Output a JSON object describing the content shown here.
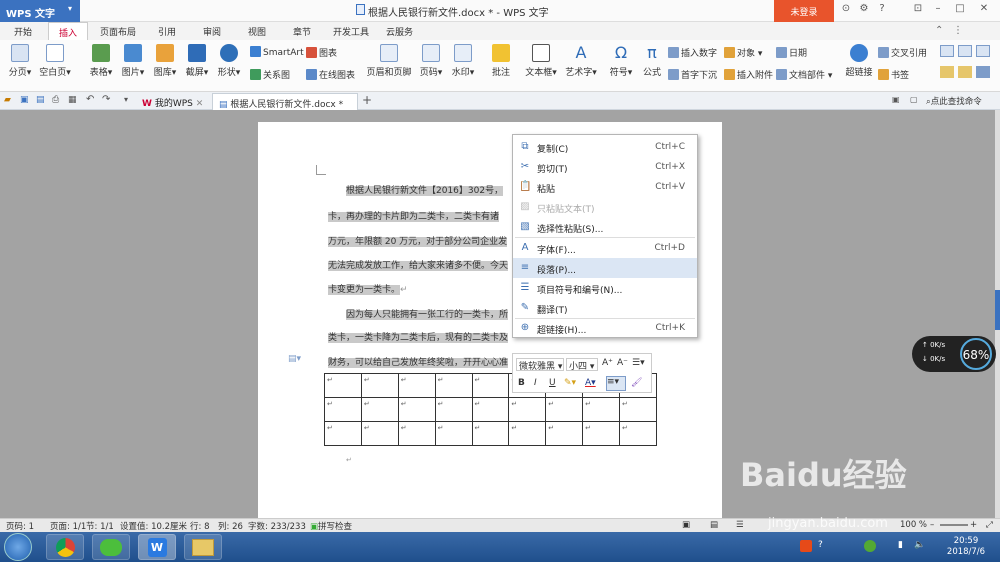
{
  "titlebar": {
    "app": "WPS 文字",
    "doc_title": "根据人民银行新文件.docx * - WPS 文字",
    "login": "未登录"
  },
  "menus": [
    "开始",
    "插入",
    "页面布局",
    "引用",
    "审阅",
    "视图",
    "章节",
    "开发工具",
    "云服务"
  ],
  "ribbon": {
    "page_group": [
      "分页",
      "空白页"
    ],
    "table": "表格",
    "picture": "图片",
    "gallery": "图库",
    "screenshot": "截屏",
    "shape": "形状",
    "smartart": "SmartArt",
    "chart": "图表",
    "relation": "关系图",
    "online_chart": "在线图表",
    "header_footer": "页眉和页脚",
    "page_num": "页码",
    "watermark": "水印",
    "comment": "批注",
    "textbox": "文本框",
    "wordart": "艺术字",
    "symbol": "符号",
    "formula": "公式",
    "insert_num": "插入数字",
    "object": "对象",
    "date": "日期",
    "dropcap": "首字下沉",
    "attachment": "插入附件",
    "docpart": "文档部件",
    "hyperlink": "超链接",
    "crossref": "交叉引用",
    "bookmark": "书签"
  },
  "tabs": {
    "mywps": "我的WPS",
    "doc": "根据人民银行新文件.docx *",
    "find": "点此查找命令"
  },
  "doc_lines": [
    "根据人民银行新文件【2016】302号，",
    "卡，再办理的卡片即为二类卡，二类卡有诸",
    "万元，年限额 20 万元，对于部分公司企业发",
    "无法完成发放工作，给大家来诸多不便。今天",
    "卡变更为一类卡。",
    "因为每人只能拥有一张工行的一类卡，所",
    "类卡，一类卡降为二类卡后，现有的二类卡及",
    "财务，可以给自己发放年终奖啦，开开心心准"
  ],
  "context_menu": [
    {
      "label": "复制(C)",
      "shortcut": "Ctrl+C",
      "icon": "copy-icon",
      "disabled": false
    },
    {
      "label": "剪切(T)",
      "shortcut": "Ctrl+X",
      "icon": "scissors-icon",
      "disabled": false
    },
    {
      "label": "粘贴",
      "shortcut": "Ctrl+V",
      "icon": "paste-icon",
      "disabled": false
    },
    {
      "label": "只粘贴文本(T)",
      "shortcut": "",
      "icon": "paste-text-icon",
      "disabled": true
    },
    {
      "label": "选择性粘贴(S)...",
      "shortcut": "",
      "icon": "paste-special-icon",
      "disabled": false
    },
    {
      "label": "字体(F)...",
      "shortcut": "Ctrl+D",
      "icon": "font-icon",
      "disabled": false
    },
    {
      "label": "段落(P)...",
      "shortcut": "",
      "icon": "paragraph-icon",
      "disabled": false
    },
    {
      "label": "项目符号和编号(N)...",
      "shortcut": "",
      "icon": "list-icon",
      "disabled": false
    },
    {
      "label": "翻译(T)",
      "shortcut": "",
      "icon": "translate-icon",
      "disabled": false
    },
    {
      "label": "超链接(H)...",
      "shortcut": "Ctrl+K",
      "icon": "link-icon",
      "disabled": false
    }
  ],
  "mini_toolbar": {
    "font": "微软雅黑",
    "size": "小四"
  },
  "statusbar": {
    "page": "页码: 1",
    "pages": "页面: 1/1",
    "section": "节: 1/1",
    "setting": "设置值: 10.2厘米",
    "row": "行: 8",
    "col": "列: 26",
    "words": "字数: 233/233",
    "spell": "拼写检查",
    "zoom": "100 %"
  },
  "clock": {
    "time": "20:59",
    "date": "2018/7/6"
  },
  "speed": {
    "up": "0K/s",
    "down": "0K/s",
    "pct": "68%"
  },
  "watermark": {
    "brand": "Baidu经验",
    "url": "jingyan.baidu.com"
  }
}
